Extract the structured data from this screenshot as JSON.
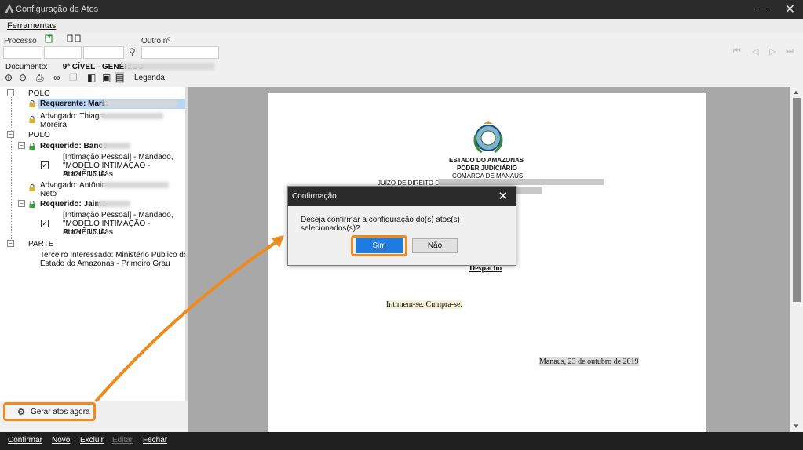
{
  "window": {
    "title": "Configuração de Atos",
    "minimize": "—",
    "close": "✕"
  },
  "menu": {
    "ferramentas": "Ferramentas"
  },
  "form": {
    "processo_label": "Processo",
    "outro_label": "Outro nº",
    "documento_label": "Documento:",
    "documento_value": "9ª CÍVEL - GENÉRICO"
  },
  "toolbar": {
    "legenda": "Legenda"
  },
  "tree": {
    "polo1": "POLO",
    "requerente": "Requerente: Maria",
    "advogado1_a": "Advogado: Thiago",
    "advogado1_b": "Moreira",
    "polo2": "POLO",
    "requerido1": "Requerido: Banco",
    "ato1_a": "[Intimação Pessoal] - Mandado,",
    "ato1_b": "\"MODELO INTIMAÇÃO - AUDIÊNCIA\" -",
    "ato1_c": "Prazo: 15 dias",
    "advogado2_a": "Advogado: Antônio",
    "advogado2_b": "Neto",
    "requerido2": "Requerido: Jaime",
    "ato2_a": "[Intimação Pessoal] - Mandado,",
    "ato2_b": "\"MODELO INTIMAÇÃO - AUDIÊNCIA\" -",
    "ato2_c": "Prazo: 15 dias",
    "parte": "PARTE",
    "terceiro_a": "Terceiro Interessado: Ministério Público do",
    "terceiro_b": "Estado do Amazonas - Primeiro Grau"
  },
  "gerar_button": "Gerar atos agora",
  "document": {
    "estado": "ESTADO DO AMAZONAS",
    "poder": "PODER JUDICIÁRIO",
    "comarca": "COMARCA DE MANAUS",
    "juizo": "JUÍZO DE DIREITO DA",
    "despacho": "Despacho",
    "body": "Intimem-se. Cumpra-se.",
    "date": "Manaus, 23 de outubro de 2019"
  },
  "dialog": {
    "title": "Confirmação",
    "message": "Deseja confirmar a configuração do(s) atos(s) selecionados(s)?",
    "sim": "Sim",
    "nao": "Não"
  },
  "bottom": {
    "confirmar": "Confirmar",
    "novo": "Novo",
    "excluir": "Excluir",
    "editar": "Editar",
    "fechar": "Fechar"
  },
  "colors": {
    "accent": "#ef8a1e",
    "primary_button": "#1e7be0"
  }
}
